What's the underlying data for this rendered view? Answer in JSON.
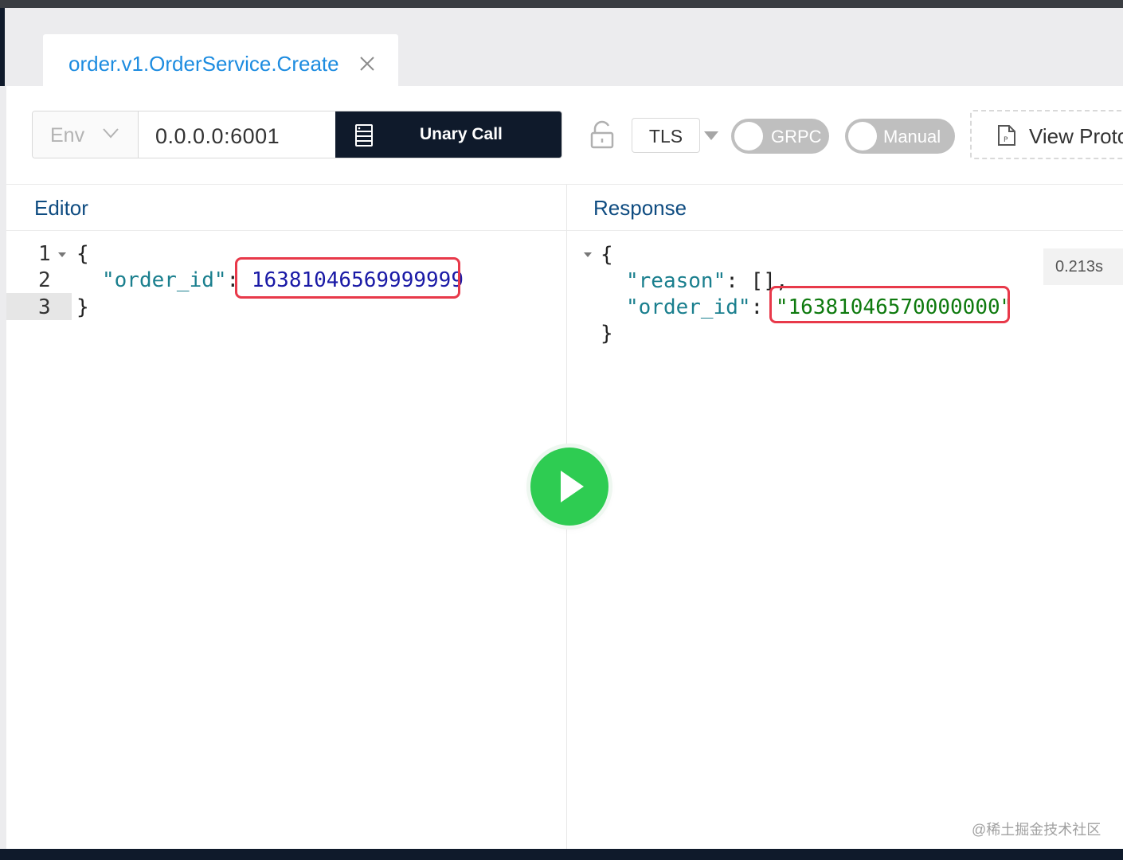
{
  "tab": {
    "label": "order.v1.OrderService.Create"
  },
  "toolbar": {
    "env_placeholder": "Env",
    "address": "0.0.0.0:6001",
    "call_type": "Unary Call",
    "tls_label": "TLS",
    "grpc_label": "GRPC",
    "grpc_enabled": false,
    "manual_label": "Manual",
    "manual_enabled": false,
    "view_proto_label": "View Proto"
  },
  "editor": {
    "title": "Editor",
    "line_numbers": [
      "1",
      "2",
      "3"
    ],
    "open_brace": "{",
    "close_brace": "}",
    "key": "\"order_id\"",
    "colon": ":",
    "value": "16381046569999999"
  },
  "response": {
    "title": "Response",
    "open_brace": "{",
    "close_brace": "}",
    "reason_key": "\"reason\"",
    "reason_sep": ": ",
    "reason_value": "[]",
    "reason_comma": ",",
    "order_key": "\"order_id\"",
    "order_sep": ": ",
    "order_value": "\"16381046570000000\"",
    "timing": "0.213s"
  },
  "watermark": "@稀土掘金技术社区",
  "colors": {
    "accent": "#1d8ce0",
    "dark": "#0f1a2b",
    "play": "#2ecc52",
    "highlight": "#e8394a"
  }
}
